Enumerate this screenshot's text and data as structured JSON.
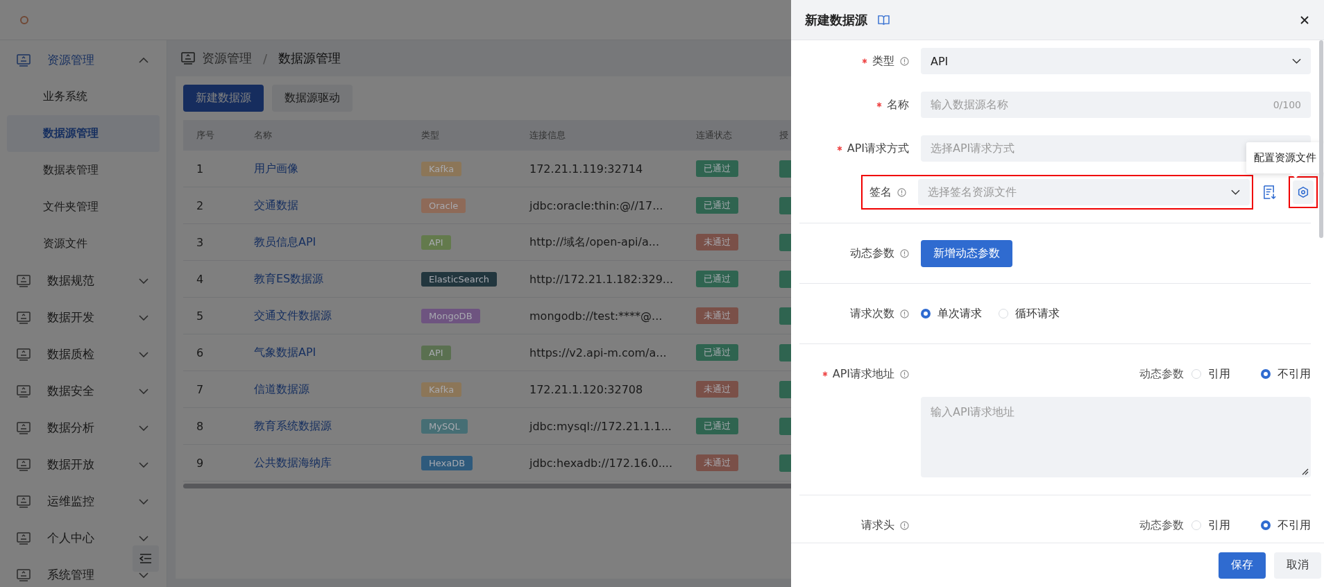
{
  "sidebar": {
    "items": [
      {
        "label": "资源管理",
        "expanded": true,
        "children": [
          {
            "label": "业务系统",
            "selected": false
          },
          {
            "label": "数据源管理",
            "selected": true
          },
          {
            "label": "数据表管理",
            "selected": false
          },
          {
            "label": "文件夹管理",
            "selected": false
          },
          {
            "label": "资源文件",
            "selected": false
          }
        ]
      },
      {
        "label": "数据规范",
        "expanded": false
      },
      {
        "label": "数据开发",
        "expanded": false
      },
      {
        "label": "数据质检",
        "expanded": false
      },
      {
        "label": "数据安全",
        "expanded": false
      },
      {
        "label": "数据分析",
        "expanded": false
      },
      {
        "label": "数据开放",
        "expanded": false
      },
      {
        "label": "运维监控",
        "expanded": false
      },
      {
        "label": "个人中心",
        "expanded": false
      },
      {
        "label": "系统管理",
        "expanded": false
      }
    ]
  },
  "breadcrumb": {
    "items": [
      "资源管理",
      "数据源管理"
    ],
    "separator": "/"
  },
  "toolbar": {
    "buttons": [
      {
        "label": "新建数据源",
        "kind": "primary"
      },
      {
        "label": "数据源驱动",
        "kind": "default"
      }
    ]
  },
  "table": {
    "columns": [
      "序号",
      "名称",
      "类型",
      "连接信息",
      "连通状态",
      "授"
    ],
    "rows": [
      {
        "index": "1",
        "name": "用户画像",
        "type": {
          "label": "Kafka",
          "color": "#8c7658"
        },
        "connection": "172.21.1.119:32714",
        "status": {
          "label": "已通过",
          "color": "#2f6450"
        },
        "column_6": {
          "color": "#2f6450"
        }
      },
      {
        "index": "2",
        "name": "交通数据",
        "type": {
          "label": "Oracle",
          "color": "#8e6a58"
        },
        "connection": "jdbc:oracle:thin:@//17...",
        "status": {
          "label": "已通过",
          "color": "#2f6450"
        },
        "column_6": {
          "color": "#2f6450"
        }
      },
      {
        "index": "3",
        "name": "教员信息API",
        "type": {
          "label": "API",
          "color": "#637a4c"
        },
        "connection": "http://域名/open-api/a...",
        "status": {
          "label": "未通过",
          "color": "#7a5048"
        },
        "column_6": {
          "color": "#2f6450"
        }
      },
      {
        "index": "4",
        "name": "教育ES数据源",
        "type": {
          "label": "ElasticSearch",
          "color": "#22363e"
        },
        "connection": "http://172.21.1.182:329...",
        "status": {
          "label": "已通过",
          "color": "#2f6450"
        },
        "column_6": {
          "color": "#2f6450"
        }
      },
      {
        "index": "5",
        "name": "交通文件数据源",
        "type": {
          "label": "MongoDB",
          "color": "#6e5480"
        },
        "connection": "mongodb://test:****@...",
        "status": {
          "label": "未通过",
          "color": "#7a5048"
        },
        "column_6": {
          "color": "#2f6450"
        }
      },
      {
        "index": "6",
        "name": "气象数据API",
        "type": {
          "label": "API",
          "color": "#5a7050"
        },
        "connection": "https://v2.api-m.com/a...",
        "status": {
          "label": "已通过",
          "color": "#2f6450"
        },
        "column_6": {
          "color": "#2f6450"
        }
      },
      {
        "index": "7",
        "name": "信道数据源",
        "type": {
          "label": "Kafka",
          "color": "#8c7658"
        },
        "connection": "172.21.1.120:32708",
        "status": {
          "label": "未通过",
          "color": "#7a5048"
        },
        "column_6": {
          "color": "#2f6450"
        }
      },
      {
        "index": "8",
        "name": "教育系统数据源",
        "type": {
          "label": "MySQL",
          "color": "#466e74"
        },
        "connection": "jdbc:mysql://172.21.1.1...",
        "status": {
          "label": "已通过",
          "color": "#2f6450"
        },
        "column_6": {
          "color": "#2f6450"
        }
      },
      {
        "index": "9",
        "name": "公共数据海纳库",
        "type": {
          "label": "HexaDB",
          "color": "#2e5a7c"
        },
        "connection": "jdbc:hexadb://172.16.0....",
        "status": {
          "label": "未通过",
          "color": "#7a5048"
        },
        "column_6": {
          "color": "#2f6450"
        }
      }
    ]
  },
  "drawer": {
    "title": "新建数据源",
    "fields": [
      {
        "kind": "select",
        "label": "类型",
        "required": true,
        "info": true,
        "value": "API"
      },
      {
        "kind": "input",
        "label": "名称",
        "required": true,
        "info": false,
        "placeholder": "输入数据源名称",
        "counter": "0/100"
      },
      {
        "kind": "input",
        "label": "API请求方式",
        "required": true,
        "info": false,
        "placeholder": "选择API请求方式"
      },
      {
        "kind": "signature",
        "label": "签名",
        "required": false,
        "info": true,
        "placeholder": "选择签名资源文件",
        "highlighted": true,
        "tooltip": "配置资源文件"
      },
      {
        "kind": "button",
        "label": "动态参数",
        "required": false,
        "info": true,
        "button": "新增动态参数"
      },
      {
        "kind": "radio",
        "label": "请求次数",
        "required": false,
        "info": true,
        "options": [
          {
            "label": "单次请求",
            "selected": true
          },
          {
            "label": "循环请求",
            "selected": false
          }
        ]
      },
      {
        "kind": "textarea",
        "label": "API请求地址",
        "required": true,
        "info": true,
        "toggle": {
          "label": "动态参数",
          "options": [
            {
              "label": "引用",
              "selected": false
            },
            {
              "label": "不引用",
              "selected": true
            }
          ]
        },
        "placeholder": "输入API请求地址"
      },
      {
        "kind": "toggle",
        "label": "请求头",
        "required": false,
        "info": true,
        "toggle": {
          "label": "动态参数",
          "options": [
            {
              "label": "引用",
              "selected": false
            },
            {
              "label": "不引用",
              "selected": true
            }
          ]
        }
      }
    ],
    "footer": {
      "buttons": [
        {
          "label": "保存",
          "kind": "primary"
        },
        {
          "label": "取消",
          "kind": "default"
        }
      ]
    }
  }
}
